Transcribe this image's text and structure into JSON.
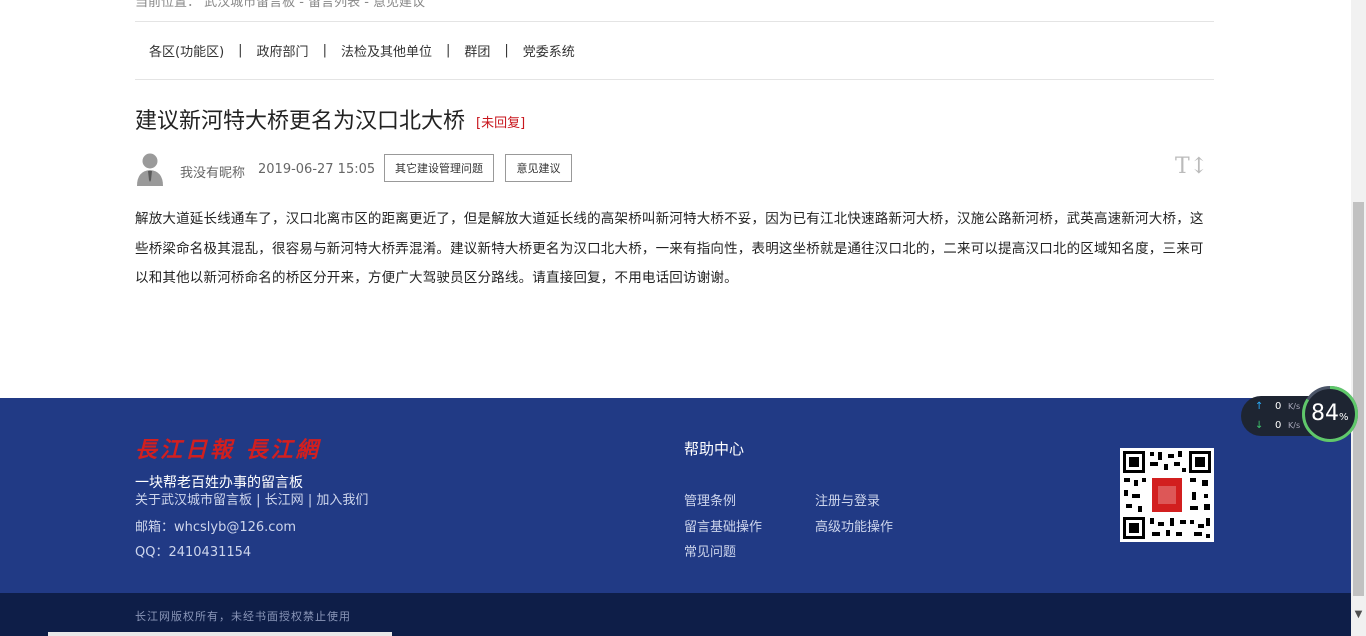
{
  "breadcrumb_cut": "当前位置：  武汉城市留言板  -  留言列表  -  意见建议",
  "nav": {
    "items": [
      "各区(功能区)",
      "政府部门",
      "法检及其他单位",
      "群团",
      "党委系统"
    ],
    "separator": "|"
  },
  "post": {
    "title": "建议新河特大桥更名为汉口北大桥",
    "status": "[未回复]",
    "author": "我没有昵称",
    "date": "2019-06-27 15:05",
    "tags": [
      "其它建设管理问题",
      "意见建议"
    ],
    "font_size_icon": "T↕",
    "body": "解放大道延长线通车了，汉口北离市区的距离更近了，但是解放大道延长线的高架桥叫新河特大桥不妥，因为已有江北快速路新河大桥，汉施公路新河桥，武英高速新河大桥，这些桥梁命名极其混乱，很容易与新河特大桥弄混淆。建议新特大桥更名为汉口北大桥，一来有指向性，表明这坐桥就是通往汉口北的，二来可以提高汉口北的区域知名度，三来可以和其他以新河桥命名的桥区分开来，方便广大驾驶员区分路线。请直接回复，不用电话回访谢谢。"
  },
  "footer": {
    "logo_text": "長江日報  長江網",
    "slogan": "一块帮老百姓办事的留言板",
    "links": [
      "关于武汉城市留言板",
      "长江网",
      "加入我们"
    ],
    "email": "邮箱：whcslyb@126.com",
    "qq": "QQ：2410431154",
    "help_title": "帮助中心",
    "help_links": [
      "管理条例",
      "注册与登录",
      "留言基础操作",
      "高级功能操作",
      "常见问题"
    ],
    "copyright": "长江网版权所有，未经书面授权禁止使用"
  },
  "widget": {
    "up_value": "0",
    "down_value": "0",
    "unit": "K/s",
    "percent": "84",
    "percent_sign": "%"
  },
  "colors": {
    "footer_bg": "#213a85",
    "copyright_bg": "#0e1e48",
    "status_red": "#c8161d",
    "logo_red": "#d21f1f"
  }
}
